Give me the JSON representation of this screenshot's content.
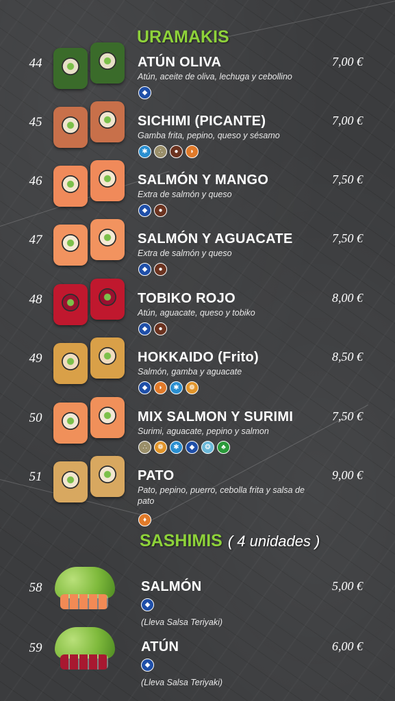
{
  "sections": {
    "uramakis": {
      "title": "URAMAKIS"
    },
    "sashimis": {
      "title": "SASHIMIS",
      "subtitle": "( 4 unidades )"
    }
  },
  "uramakis": [
    {
      "num": "44",
      "name": "ATÚN OLIVA",
      "desc": "Atún, aceite de oliva, lechuga y cebollino",
      "price": "7,00 €",
      "icons": [
        {
          "name": "fish-icon",
          "color": "#1f4fa8"
        }
      ],
      "colors": [
        "#3a6b2a",
        "#e8e0c8"
      ]
    },
    {
      "num": "45",
      "name": "SICHIMI (PICANTE)",
      "desc": "Gamba frita, pepino, queso y sésamo",
      "price": "7,00 €",
      "icons": [
        {
          "name": "crab-icon",
          "color": "#2a8fd0"
        },
        {
          "name": "sesame-icon",
          "color": "#9a8f6a"
        },
        {
          "name": "milk-icon",
          "color": "#6b3320"
        },
        {
          "name": "shrimp-icon",
          "color": "#e07a2a"
        }
      ],
      "colors": [
        "#c8704a",
        "#f0e6d0"
      ]
    },
    {
      "num": "46",
      "name": "SALMÓN Y MANGO",
      "desc": "Extra de salmón y queso",
      "price": "7,50 €",
      "icons": [
        {
          "name": "fish-icon",
          "color": "#1f4fa8"
        },
        {
          "name": "milk-icon",
          "color": "#6b3320"
        }
      ],
      "colors": [
        "#f08a5a",
        "#f5e8d0"
      ]
    },
    {
      "num": "47",
      "name": "SALMÓN Y AGUACATE",
      "desc": "Extra de salmón y queso",
      "price": "7,50 €",
      "icons": [
        {
          "name": "fish-icon",
          "color": "#1f4fa8"
        },
        {
          "name": "milk-icon",
          "color": "#6b3320"
        }
      ],
      "colors": [
        "#f2935f",
        "#f5ead5"
      ]
    },
    {
      "num": "48",
      "name": "TOBIKO ROJO",
      "desc": "Atún, aguacate, queso y tobiko",
      "price": "8,00 €",
      "icons": [
        {
          "name": "fish-icon",
          "color": "#1f4fa8"
        },
        {
          "name": "milk-icon",
          "color": "#6b3320"
        }
      ],
      "colors": [
        "#c0182e",
        "#9a1030"
      ]
    },
    {
      "num": "49",
      "name": "HOKKAIDO (Frito)",
      "desc": "Salmón, gamba y aguacate",
      "price": "8,50 €",
      "icons": [
        {
          "name": "fish-icon",
          "color": "#1f4fa8"
        },
        {
          "name": "shrimp-icon",
          "color": "#e07a2a"
        },
        {
          "name": "crab-icon",
          "color": "#2a8fd0"
        },
        {
          "name": "egg-icon",
          "color": "#e0942a"
        }
      ],
      "colors": [
        "#d9a048",
        "#f0dcc0"
      ]
    },
    {
      "num": "50",
      "name": "MIX SALMON Y  SURIMI",
      "desc": "Surimi, aguacate, pepino y salmon",
      "price": "7,50 €",
      "icons": [
        {
          "name": "sesame-icon",
          "color": "#9a8f6a"
        },
        {
          "name": "egg-icon",
          "color": "#e0942a"
        },
        {
          "name": "crab-icon",
          "color": "#2a8fd0"
        },
        {
          "name": "fish-icon",
          "color": "#1f4fa8"
        },
        {
          "name": "shell-icon",
          "color": "#6ab8d8"
        },
        {
          "name": "celery-icon",
          "color": "#2a9a3a"
        }
      ],
      "colors": [
        "#f0905a",
        "#f2e8d6"
      ]
    },
    {
      "num": "51",
      "name": "PATO",
      "desc": "Pato, pepino, puerro, cebolla frita y salsa de pato",
      "price": "9,00 €",
      "icons": [
        {
          "name": "gluten-icon",
          "color": "#e07a2a"
        }
      ],
      "colors": [
        "#d8a860",
        "#f2e6d0"
      ]
    }
  ],
  "sashimis": [
    {
      "num": "58",
      "name": "SALMÓN",
      "price": "5,00 €",
      "note": "(Lleva Salsa Teriyaki)",
      "icons": [
        {
          "name": "fish-icon",
          "color": "#1f4fa8"
        }
      ],
      "fish_color": "#f28a55"
    },
    {
      "num": "59",
      "name": "ATÚN",
      "price": "6,00 €",
      "note": "(Lleva Salsa Teriyaki)",
      "icons": [
        {
          "name": "fish-icon",
          "color": "#1f4fa8"
        }
      ],
      "fish_color": "#a81830"
    }
  ]
}
